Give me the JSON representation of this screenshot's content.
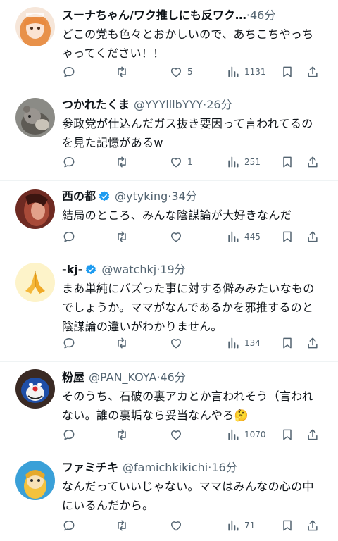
{
  "tweets": [
    {
      "name": "スーナちゃん/ワク推しにも反ワク…",
      "handle": "",
      "time": "46分",
      "text": "どこの党も色々とおかしいので、あちこちやっちゃってください！！",
      "likes": "5",
      "views": "1131",
      "verified": false,
      "avatar_icon": "avatar-girl-orange-hair"
    },
    {
      "name": "つかれたくま",
      "handle": "@YYYlllbYYY",
      "time": "26分",
      "text": "参政党が仕込んだガス抜き要因って言われてるのを見た記憶があるw",
      "likes": "1",
      "views": "251",
      "verified": false,
      "avatar_icon": "avatar-plush-toy"
    },
    {
      "name": "西の都",
      "handle": "@ytyking",
      "time": "34分",
      "text": "結局のところ、みんな陰謀論が大好きなんだ",
      "likes": "",
      "views": "445",
      "verified": true,
      "avatar_icon": "avatar-woman-red"
    },
    {
      "name": "-kj-",
      "handle": "@watchkj",
      "time": "19分",
      "text": "まあ単純にバズった事に対する僻みみたいなものでしょうか。ママがなんであるかを邪推するのと陰謀論の違いがわかりません。",
      "likes": "",
      "views": "134",
      "verified": true,
      "avatar_icon": "avatar-praying-hands"
    },
    {
      "name": "粉屋",
      "handle": "@PAN_KOYA",
      "time": "46分",
      "text": "そのうち、石破の裏アカとか言われそう（言われない。誰の裏垢なら妥当なんやろ🤔",
      "likes": "",
      "views": "1070",
      "verified": false,
      "avatar_icon": "avatar-character"
    },
    {
      "name": "ファミチキ",
      "handle": "@famichkikichi",
      "time": "16分",
      "text": "なんだっていいじゃない。ママはみんなの心の中にいるんだから。",
      "likes": "",
      "views": "71",
      "verified": false,
      "avatar_icon": "avatar-anime-character"
    }
  ],
  "separator": "·",
  "colors": {
    "text": "#0f1419",
    "secondary": "#536471",
    "divider": "#eff3f4",
    "verified": "#1d9bf0"
  }
}
